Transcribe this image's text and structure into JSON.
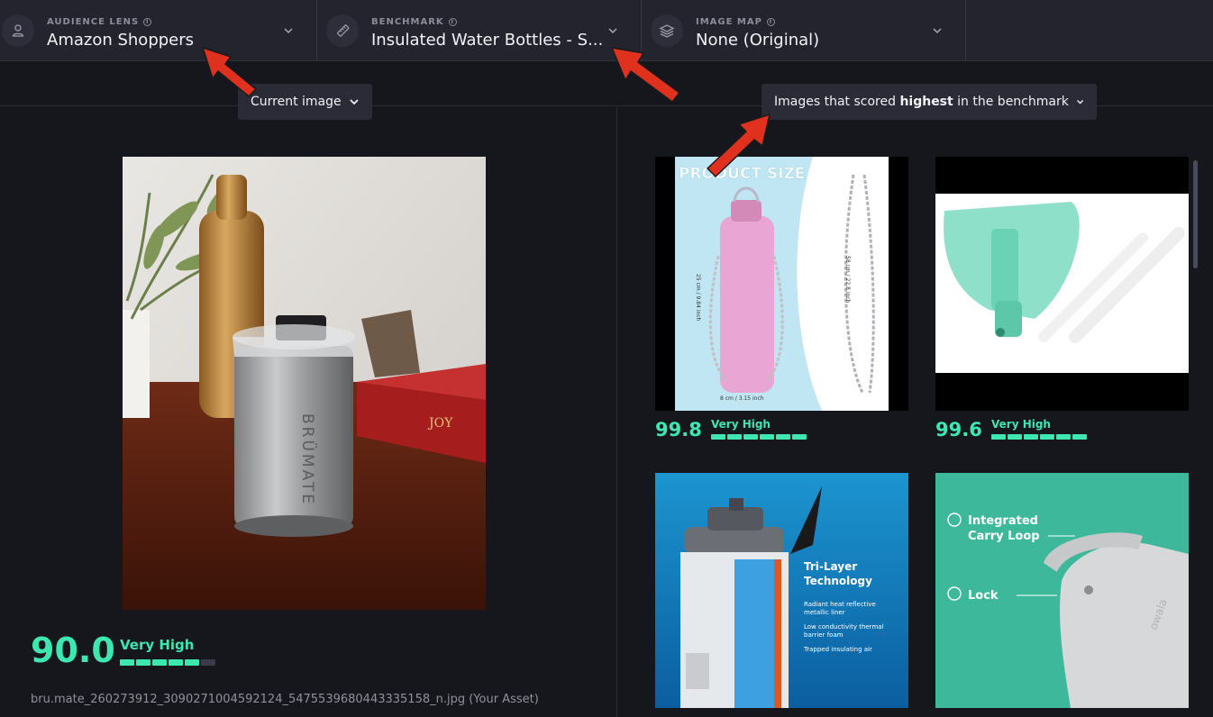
{
  "selectors": {
    "audience": {
      "label": "AUDIENCE LENS",
      "value": "Amazon Shoppers",
      "icon": "user-icon"
    },
    "benchmark": {
      "label": "BENCHMARK",
      "value": "Insulated Water Bottles - S...",
      "icon": "ruler-icon"
    },
    "image_map": {
      "label": "IMAGE MAP",
      "value": "None (Original)",
      "icon": "layers-icon"
    }
  },
  "current_dropdown": {
    "label": "Current image"
  },
  "benchmark_dropdown": {
    "prefix": "Images that scored ",
    "bold": "highest",
    "suffix": " in the benchmark"
  },
  "current": {
    "score": "90.0",
    "level": "Very High",
    "level_fraction": 0.9,
    "filename": "bru.mate_260273912_3090271004592124_5475539680443335158_n.jpg (Your Asset)",
    "brand_text": "BRÜMATE",
    "book_text": "JOY"
  },
  "benchmark_images": [
    {
      "score": "99.8",
      "level": "Very High",
      "texts": [
        "PRODUCT SIZE",
        "25 cm / 9.84 inch",
        "58 cm / 22.8 inch",
        "8 cm / 3.15 inch"
      ]
    },
    {
      "score": "99.6",
      "level": "Very High"
    },
    {
      "score": "",
      "level": "",
      "texts": [
        "Tri-Layer",
        "Technology",
        "Radiant heat reflective",
        "metallic liner",
        "Low conductivity thermal",
        "barrier foam",
        "Trapped insulating air"
      ]
    },
    {
      "score": "",
      "level": "",
      "texts": [
        "Integrated",
        "Carry Loop",
        "Lock",
        "owala"
      ]
    }
  ],
  "colors": {
    "accent": "#3ee6b0",
    "arrow": "#e0301e",
    "background": "#16171d",
    "panel": "#23242e"
  }
}
